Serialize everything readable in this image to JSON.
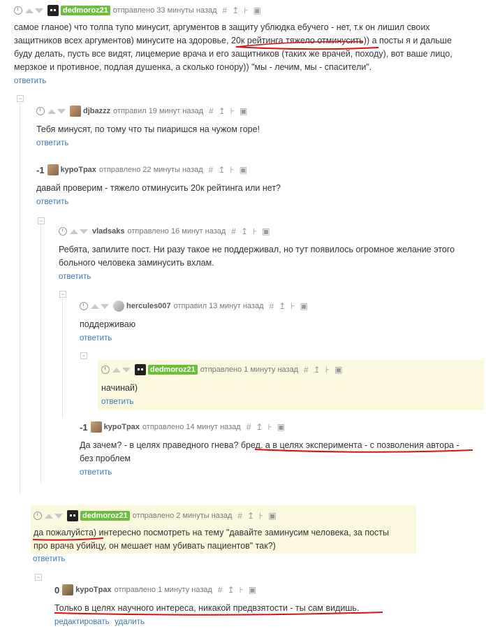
{
  "action_icons": [
    "hash-icon",
    "share-icon",
    "tree-icon",
    "save-icon"
  ],
  "colors": {
    "link": "#3a78b5",
    "highlight": "#fbf8dd",
    "username_badge": "#6bbf3c",
    "underline": "#d8120f"
  },
  "comments": [
    {
      "user": "dedmoroz21",
      "verb": "отправлено 33 минуты назад",
      "rating": "",
      "text": "самое гланое) что толпа тупо минусит, аргументов в защиту ублюдка ебучего - нет, т.к он лишил своих защитников всех аргументов) минусите на здоровье, 20к рейтинга тяжело отминусить)) а посты я и дальше буду делать, пусть все видят, лицемерие врача и его защитников (таких же врачей, походу), вот ваше лицо, мерзкое и противное, подлая душенка, а сколько гонору)) \"мы - лечим, мы - спасители\".",
      "reply": "ответить"
    },
    {
      "user": "djbazzz",
      "verb": "отправил 19 минут назад",
      "rating": "",
      "text": "Тебя минусят, по тому что ты пиаришся на чужом горе!",
      "reply": "ответить"
    },
    {
      "user": "kypoTpax",
      "verb": "отправлено 22 минуты назад",
      "rating": "-1",
      "text": "давай проверим - тяжело отминусить 20к рейтинга или нет?",
      "reply": "ответить"
    },
    {
      "user": "vladsaks",
      "verb": "отправлено 16 минут назад",
      "rating": "",
      "text": "Ребята, запилите пост. Ни разу такое не поддерживал, но тут появилось огромное желание этого больного человека заминусить вхлам.",
      "reply": "ответить"
    },
    {
      "user": "hercules007",
      "verb": "отправил 13 минут назад",
      "rating": "",
      "text": "поддерживаю",
      "reply": "ответить"
    },
    {
      "user": "dedmoroz21",
      "verb": "отправлено 1 минуту назад",
      "rating": "",
      "text": "начинай)",
      "reply": "ответить"
    },
    {
      "user": "kypoTpax",
      "verb": "отправлено 14 минут назад",
      "rating": "-1",
      "text": "Да зачем? - в целях праведного гнева? бред. а в целях эксперимента - с позволения автора - без проблем",
      "reply": "ответить"
    },
    {
      "user": "dedmoroz21",
      "verb": "отправлено 2 минуты назад",
      "rating": "",
      "text": "да пожалуйста) интересно посмотреть на тему \"давайте заминусим человека, за посты про врача убийцу, он мешает нам убивать пациентов\" так?)",
      "reply": "ответить"
    },
    {
      "user": "kypoTpax",
      "verb": "отправлено 1 минуту назад",
      "rating": "0",
      "text": "Только в целях научного интереса, никакой предвзятости  - ты сам видишь.",
      "reply": "редактировать",
      "reply2": "удалить"
    }
  ]
}
